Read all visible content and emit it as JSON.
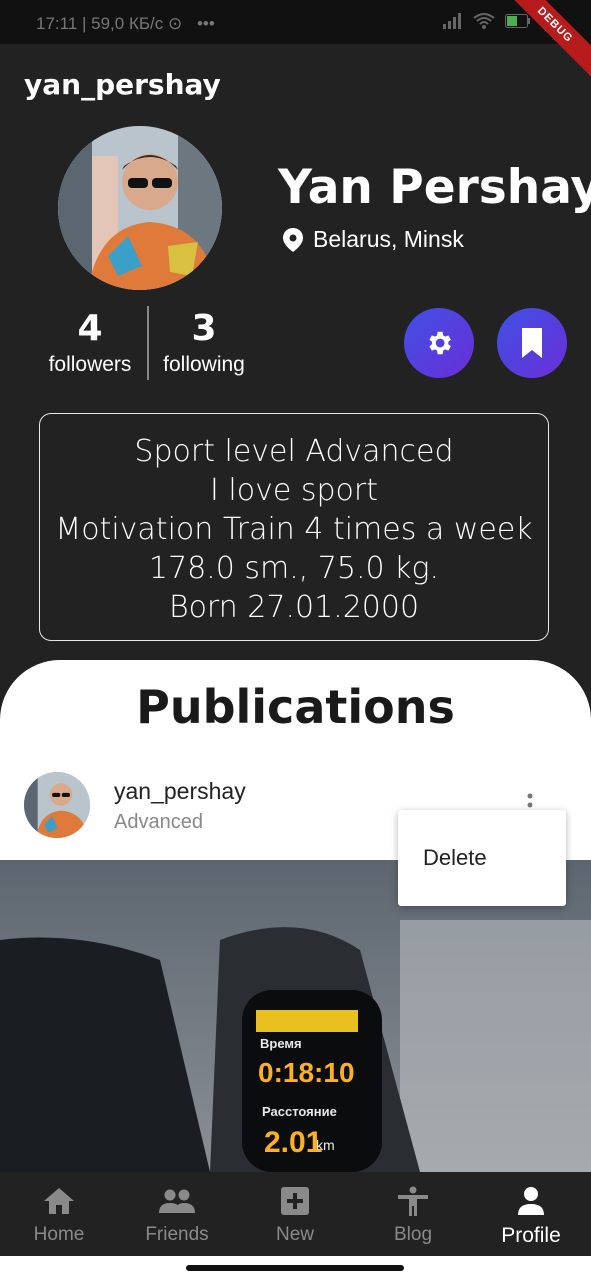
{
  "status_bar": {
    "time_net": "17:11 | 59,0 КБ/с",
    "dots": "•••",
    "debug_label": "DEBUG"
  },
  "header": {
    "username": "yan_pershay"
  },
  "profile": {
    "full_name": "Yan Pershay",
    "location": "Belarus,  Minsk",
    "followers_count": "4",
    "followers_label": "followers",
    "following_count": "3",
    "following_label": "following"
  },
  "bio": {
    "lines": [
      "Sport level Advanced",
      "I love sport",
      "Motivation Train 4 times a week",
      "178.0 sm., 75.0 kg.",
      "Born 27.01.2000"
    ]
  },
  "publications": {
    "title": "Publications",
    "post": {
      "username": "yan_pershay",
      "level": "Advanced",
      "image_desc_labels": {
        "time": "0:18:10",
        "distance": "2.01",
        "unit": "km"
      }
    },
    "menu": {
      "delete_label": "Delete"
    }
  },
  "bottom_nav": {
    "items": [
      {
        "label": "Home",
        "icon": "home-icon"
      },
      {
        "label": "Friends",
        "icon": "people-icon"
      },
      {
        "label": "New",
        "icon": "add-box-icon"
      },
      {
        "label": "Blog",
        "icon": "person-stretch-icon"
      },
      {
        "label": "Profile",
        "icon": "person-icon"
      }
    ],
    "active": "Profile"
  },
  "colors": {
    "background": "#222222",
    "accent_gradient_start": "#3f51e5",
    "accent_gradient_end": "#6a2ed6",
    "debug_ribbon": "#b71c1c"
  }
}
